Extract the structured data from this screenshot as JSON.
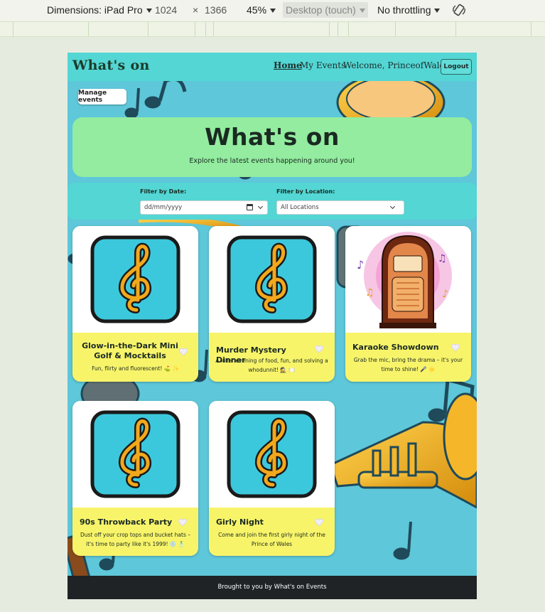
{
  "devtools": {
    "device": "Dimensions: iPad Pro",
    "width": "1024",
    "times": "×",
    "height": "1366",
    "zoom": "45%",
    "mode": "Desktop (touch)",
    "throttling": "No throttling"
  },
  "nav": {
    "brand": "What's on",
    "home": "Home",
    "my_events": "My Events",
    "welcome": "Welcome, PrinceofWales!",
    "logout": "Logout"
  },
  "manage_events": "Manage events",
  "hero": {
    "title": "What's on",
    "subtitle": "Explore the latest events happening around you!"
  },
  "filters": {
    "date_label": "Filter by Date:",
    "date_placeholder": "dd/mm/yyyy",
    "location_label": "Filter by Location:",
    "location_value": "All Locations"
  },
  "events": [
    {
      "title": "Glow-in-the-Dark Mini Golf & Mocktails",
      "description": "Fun, flirty and fluorescent! ⛳ ✨",
      "image": "treble-clef-icon"
    },
    {
      "title": "Murder Mystery Dinner",
      "description": "A killer evening of food, fun, and solving a whodunnit! 🕵️ 🍽️",
      "image": "treble-clef-icon"
    },
    {
      "title": "Karaoke Showdown",
      "description": "Grab the mic, bring the drama – it's your time to shine! 🎤 🌟",
      "image": "jukebox-image"
    },
    {
      "title": "90s Throwback Party",
      "description": "Dust off your crop tops and bucket hats – it's time to party like it's 1999! 💿 🕺",
      "image": "treble-clef-icon"
    },
    {
      "title": "Girly Night",
      "description": "Come and join the first girly night of the Prince of Wales",
      "image": "treble-clef-icon"
    }
  ],
  "footer": "Brought to you by What's on Events",
  "colors": {
    "navbar": "#53d6d4",
    "hero": "#93ec9f",
    "card_body": "#f8f46a",
    "footer": "#1f2326",
    "icon_tile": "#3cc8dc",
    "icon_clef": "#f2a81c"
  }
}
